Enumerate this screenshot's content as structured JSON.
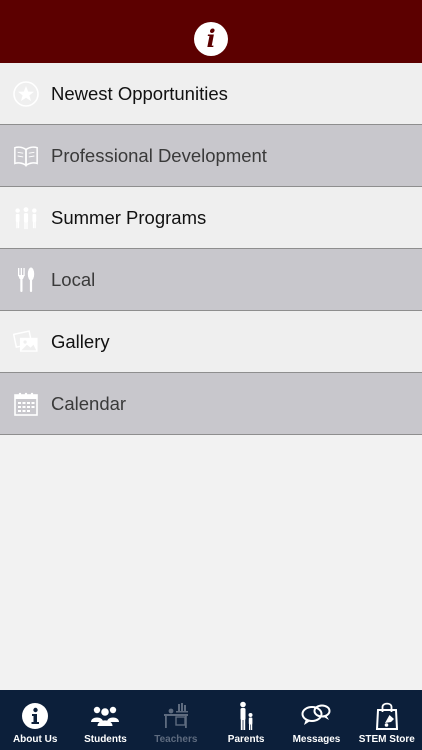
{
  "header": {
    "icon": "info-icon",
    "badge_text": "i"
  },
  "menu": {
    "items": [
      {
        "label": "Newest Opportunities",
        "icon": "star-circle-icon"
      },
      {
        "label": "Professional Development",
        "icon": "open-book-icon"
      },
      {
        "label": "Summer Programs",
        "icon": "people-group-icon"
      },
      {
        "label": "Local",
        "icon": "fork-knife-icon"
      },
      {
        "label": "Gallery",
        "icon": "photos-icon"
      },
      {
        "label": "Calendar",
        "icon": "calendar-icon"
      }
    ]
  },
  "tabbar": {
    "tabs": [
      {
        "label": "About Us",
        "icon": "info-icon"
      },
      {
        "label": "Students",
        "icon": "students-icon"
      },
      {
        "label": "Teachers",
        "icon": "teacher-desk-icon"
      },
      {
        "label": "Parents",
        "icon": "parent-child-icon"
      },
      {
        "label": "Messages",
        "icon": "chat-bubbles-icon"
      },
      {
        "label": "STEM Store",
        "icon": "shopping-bag-icon"
      }
    ]
  },
  "colors": {
    "header_bg": "#5c0000",
    "tabbar_bg": "#0c1f3a",
    "row_light": "#efefef",
    "row_dark": "#c8c7cc",
    "tab_inactive": "#5e6b7f"
  }
}
